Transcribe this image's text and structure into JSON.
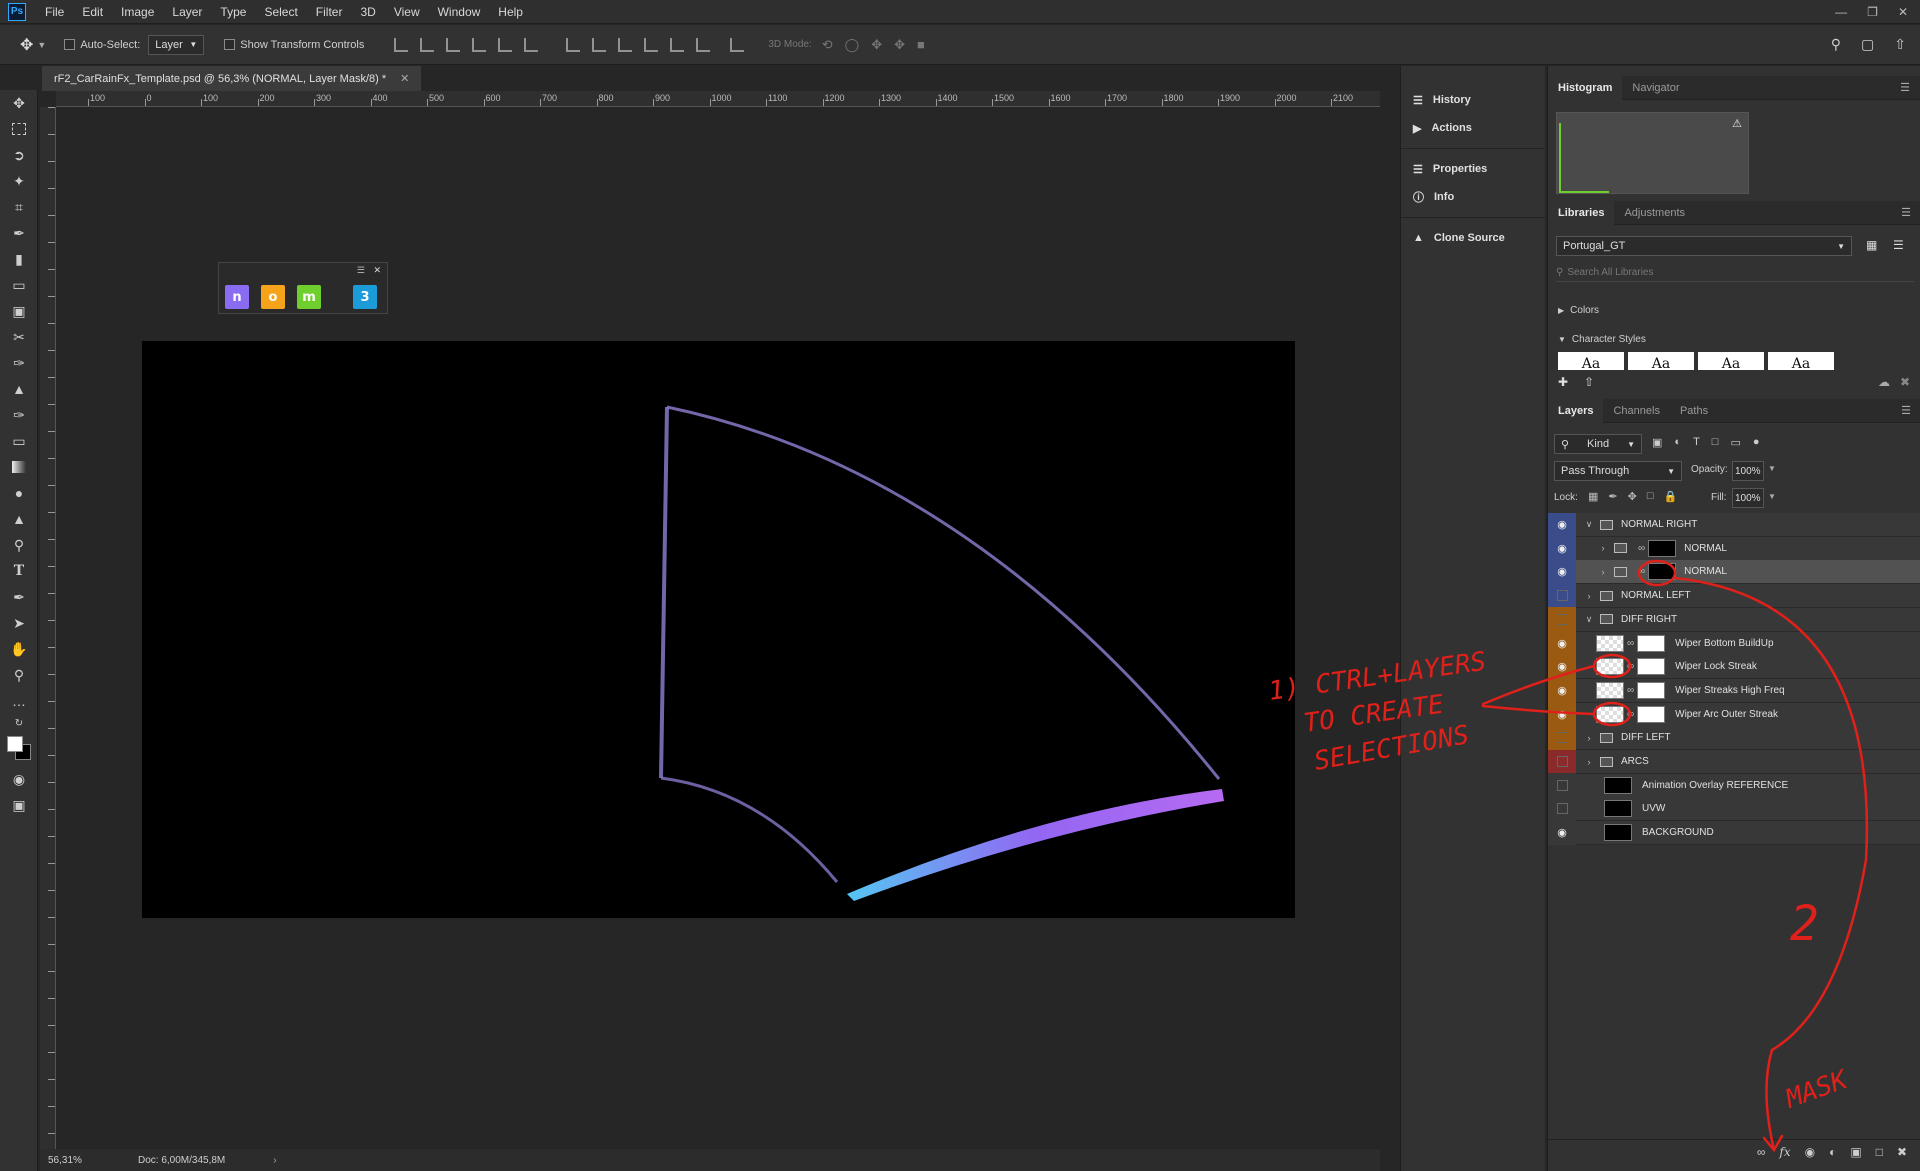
{
  "menubar": {
    "logo": "Ps",
    "items": [
      "File",
      "Edit",
      "Image",
      "Layer",
      "Type",
      "Select",
      "Filter",
      "3D",
      "View",
      "Window",
      "Help"
    ]
  },
  "options": {
    "auto_select": "Auto-Select:",
    "layer_dropdown": "Layer",
    "show_transform": "Show Transform Controls",
    "mode_3d": "3D Mode:"
  },
  "document": {
    "tab_title": "rF2_CarRainFx_Template.psd @ 56,3% (NORMAL, Layer Mask/8) *",
    "ruler_top": [
      "100",
      "0",
      "100",
      "200",
      "300",
      "400",
      "500",
      "600",
      "700",
      "800",
      "900",
      "1000",
      "1100",
      "1200",
      "1300",
      "1400",
      "1500",
      "1600",
      "1700",
      "1800",
      "1900",
      "2000",
      "2100"
    ],
    "zoom": "56,31%",
    "doc_size": "Doc: 6,00M/345,8M"
  },
  "plugins": {
    "items": [
      "n",
      "o",
      "m",
      "3"
    ]
  },
  "dock": {
    "items": [
      "History",
      "Actions",
      "Properties",
      "Info",
      "Clone Source"
    ]
  },
  "histogram": {
    "tabs": [
      "Histogram",
      "Navigator"
    ]
  },
  "libraries": {
    "tabs": [
      "Libraries",
      "Adjustments"
    ],
    "library_name": "Portugal_GT",
    "search_placeholder": "Search All Libraries",
    "sections": [
      "Colors",
      "Character Styles"
    ],
    "style_samples": [
      "Aa",
      "Aa",
      "Aa",
      "Aa"
    ]
  },
  "layers_panel": {
    "tabs": [
      "Layers",
      "Channels",
      "Paths"
    ],
    "kind": "Kind",
    "blend_mode": "Pass Through",
    "opacity_label": "Opacity:",
    "opacity_value": "100%",
    "lock_label": "Lock:",
    "fill_label": "Fill:",
    "fill_value": "100%",
    "layers": [
      {
        "name": "NORMAL RIGHT",
        "visible": true,
        "color": "#3a4d8a",
        "type": "group-open",
        "indent": 0
      },
      {
        "name": "NORMAL",
        "visible": true,
        "color": "#3a4d8a",
        "type": "group-masked",
        "indent": 1
      },
      {
        "name": "NORMAL",
        "visible": true,
        "color": "#3a4d8a",
        "type": "group-masked",
        "indent": 1,
        "selected": true
      },
      {
        "name": "NORMAL LEFT",
        "visible": false,
        "color": "#3a4d8a",
        "type": "group",
        "indent": 0
      },
      {
        "name": "DIFF RIGHT",
        "visible": false,
        "color": "#9a5a12",
        "type": "group-open",
        "indent": 0
      },
      {
        "name": "Wiper Bottom BuildUp",
        "visible": true,
        "color": "#9a5a12",
        "type": "layer-masked",
        "indent": 1
      },
      {
        "name": "Wiper Lock Streak",
        "visible": true,
        "color": "#9a5a12",
        "type": "layer-masked",
        "indent": 1
      },
      {
        "name": "Wiper Streaks High Freq",
        "visible": true,
        "color": "#9a5a12",
        "type": "layer-masked",
        "indent": 1
      },
      {
        "name": "Wiper Arc Outer Streak",
        "visible": true,
        "color": "#9a5a12",
        "type": "layer-masked",
        "indent": 1
      },
      {
        "name": "DIFF LEFT",
        "visible": false,
        "color": "#9a5a12",
        "type": "group",
        "indent": 0
      },
      {
        "name": "ARCS",
        "visible": false,
        "color": "#8a2a2a",
        "type": "group",
        "indent": 0
      },
      {
        "name": "Animation Overlay REFERENCE",
        "visible": false,
        "color": "",
        "type": "layer",
        "indent": 0
      },
      {
        "name": "UVW",
        "visible": false,
        "color": "",
        "type": "layer",
        "indent": 0
      },
      {
        "name": "BACKGROUND",
        "visible": true,
        "color": "",
        "type": "layer",
        "indent": 0
      }
    ],
    "footer_icons": [
      "link-icon",
      "fx-icon",
      "add-mask-icon",
      "adjustment-icon",
      "new-group-icon",
      "new-layer-icon",
      "trash-icon"
    ]
  },
  "annotations": {
    "step1": [
      "1) CTRL+LAYERS",
      "TO CREATE",
      "SELECTIONS"
    ],
    "step2": "2",
    "mask": "MASK"
  },
  "colors": {
    "annotation_red": "#e0201a",
    "accent_blue": "#31a8ff"
  }
}
